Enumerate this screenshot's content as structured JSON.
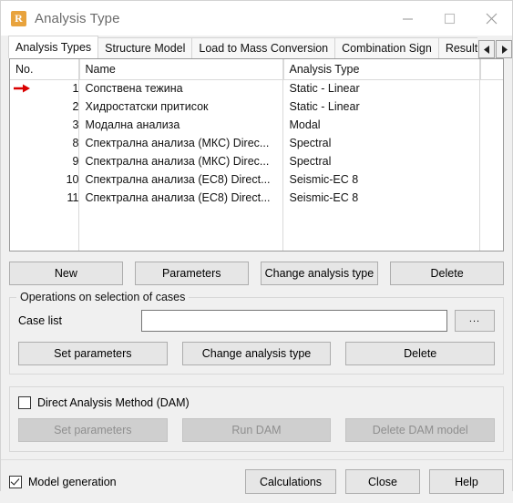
{
  "window": {
    "title": "Analysis Type",
    "icon": "robot-r-icon",
    "controls": {
      "minimize": "minimize-icon",
      "maximize": "maximize-icon",
      "close": "close-icon"
    }
  },
  "tabs": {
    "items": [
      {
        "label": "Analysis Types",
        "active": true
      },
      {
        "label": "Structure Model",
        "active": false
      },
      {
        "label": "Load to Mass Conversion",
        "active": false
      },
      {
        "label": "Combination Sign",
        "active": false
      },
      {
        "label": "Result",
        "active": false
      }
    ],
    "scroll_left": "◄",
    "scroll_right": "►"
  },
  "table": {
    "columns": [
      "No.",
      "Name",
      "Analysis Type"
    ],
    "rows": [
      {
        "no": "1",
        "name": "Сопствена тежина",
        "type": "Static - Linear",
        "marked": true
      },
      {
        "no": "2",
        "name": "Хидростатски притисок",
        "type": "Static - Linear",
        "marked": false
      },
      {
        "no": "3",
        "name": "Модална анализа",
        "type": "Modal",
        "marked": false
      },
      {
        "no": "8",
        "name": "Спектрална анализа (МКС) Direc...",
        "type": "Spectral",
        "marked": false
      },
      {
        "no": "9",
        "name": "Спектрална анализа (МКС) Direc...",
        "type": "Spectral",
        "marked": false
      },
      {
        "no": "10",
        "name": "Спектрална анализа (ЕС8) Direct...",
        "type": "Seismic-EC 8",
        "marked": false
      },
      {
        "no": "11",
        "name": "Спектрална анализа (ЕС8) Direct...",
        "type": "Seismic-EC 8",
        "marked": false
      }
    ],
    "marker_color": "#d90000"
  },
  "main_buttons": {
    "new": "New",
    "parameters": "Parameters",
    "change_analysis_type": "Change analysis type",
    "delete": "Delete"
  },
  "operations_group": {
    "title": "Operations on selection of cases",
    "case_list_label": "Case list",
    "case_list_value": "",
    "case_list_placeholder": "",
    "browse_label": "...",
    "set_parameters": "Set parameters",
    "change_analysis_type": "Change analysis type",
    "delete": "Delete"
  },
  "dam": {
    "checkbox_label": "Direct Analysis Method (DAM)",
    "checked": false,
    "set_parameters": "Set parameters",
    "run_dam": "Run DAM",
    "delete_dam_model": "Delete DAM model"
  },
  "footer": {
    "model_generation_label": "Model generation",
    "model_generation_checked": true,
    "calculations": "Calculations",
    "close": "Close",
    "help": "Help"
  }
}
